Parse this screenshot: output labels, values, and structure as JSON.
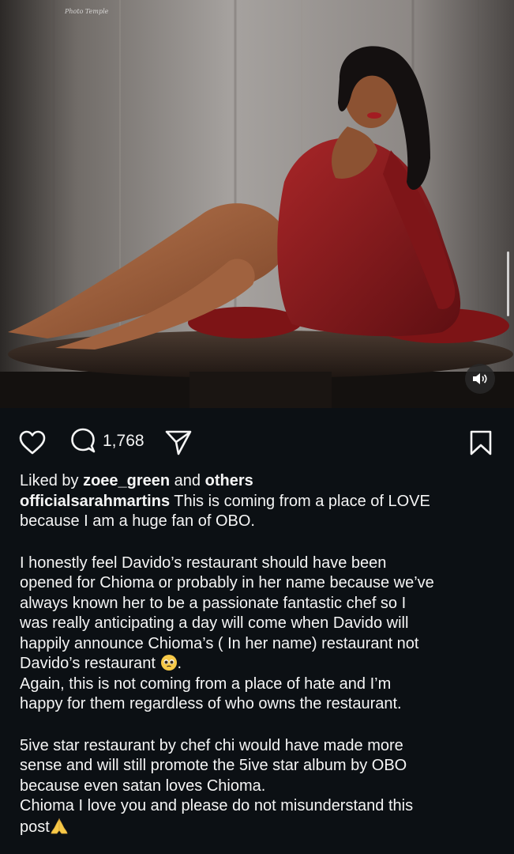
{
  "post": {
    "watermark": "Photo Temple",
    "comment_count": "1,768",
    "liked_by": {
      "prefix": "Liked by ",
      "user": "zoee_green",
      "middle": " and ",
      "others": "others"
    },
    "caption": {
      "username": "officialsarahmartins",
      "line1_rest": " This is coming from a place of LOVE",
      "line2": "because I am a huge fan of OBO.",
      "para2_l1": "I honestly feel Davido’s restaurant should have been",
      "para2_l2": "opened for Chioma or probably in her name because we’ve",
      "para2_l3": "always known her to be a passionate fantastic chef so I",
      "para2_l4": "was really anticipating a day will come when Davido will",
      "para2_l5": "happily announce Chioma’s ( In her name) restaurant not",
      "para2_l6": "Davido’s restaurant ",
      "para2_l6_end": ".",
      "para3_l1": "Again, this is not coming from a place of hate and I’m",
      "para3_l2": "happy for them regardless of who owns the restaurant.",
      "para4_l1": "5ive star restaurant by chef chi would have made more",
      "para4_l2": "sense and will still promote the 5ive star album by OBO",
      "para4_l3": "because even satan loves Chioma.",
      "para5_l1": "Chioma I love you and please do not misunderstand this",
      "para5_l2": "post"
    }
  },
  "icons": {
    "like": "heart-icon",
    "comment": "comment-bubble-icon",
    "share": "paper-plane-icon",
    "save": "bookmark-icon",
    "sound": "speaker-icon",
    "emoji1": "pleading-face-emoji",
    "emoji2": "folded-hands-emoji"
  },
  "colors": {
    "background": "#0c1014",
    "text": "#f5f5f5",
    "dress": "#8e1c1e"
  }
}
